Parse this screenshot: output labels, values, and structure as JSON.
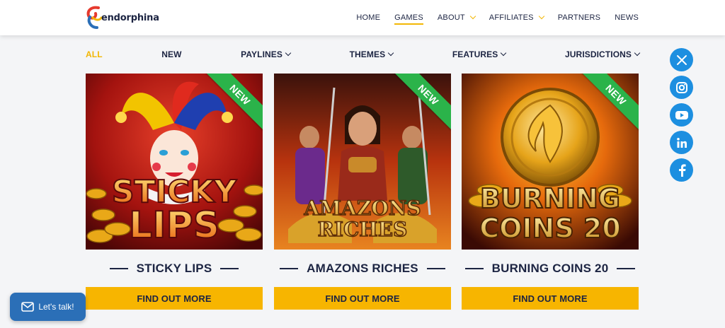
{
  "brand": {
    "name": "endorphina"
  },
  "nav": {
    "items": [
      {
        "label": "HOME",
        "dropdown": false,
        "active": false
      },
      {
        "label": "GAMES",
        "dropdown": false,
        "active": true
      },
      {
        "label": "ABOUT",
        "dropdown": true,
        "active": false
      },
      {
        "label": "AFFILIATES",
        "dropdown": true,
        "active": false
      },
      {
        "label": "PARTNERS",
        "dropdown": false,
        "active": false
      },
      {
        "label": "NEWS",
        "dropdown": false,
        "active": false
      }
    ]
  },
  "filters": {
    "items": [
      {
        "label": "ALL",
        "active": true,
        "dropdown": false
      },
      {
        "label": "NEW",
        "active": false,
        "dropdown": false
      },
      {
        "label": "PAYLINES",
        "active": false,
        "dropdown": true
      },
      {
        "label": "THEMES",
        "active": false,
        "dropdown": true
      },
      {
        "label": "FEATURES",
        "active": false,
        "dropdown": true
      },
      {
        "label": "JURISDICTIONS",
        "active": false,
        "dropdown": true
      }
    ]
  },
  "games": [
    {
      "title": "STICKY LIPS",
      "artwork_text": [
        "STICKY",
        "LIPS"
      ],
      "badge": "NEW",
      "cta": "FIND OUT MORE"
    },
    {
      "title": "AMAZONS RICHES",
      "artwork_text": [
        "AMAZONS",
        "RICHES"
      ],
      "badge": "NEW",
      "cta": "FIND OUT MORE"
    },
    {
      "title": "BURNING COINS 20",
      "artwork_text": [
        "BURNING",
        "COINS 20"
      ],
      "badge": "NEW",
      "cta": "FIND OUT MORE"
    }
  ],
  "social": {
    "items": [
      {
        "icon": "x-icon"
      },
      {
        "icon": "instagram-icon"
      },
      {
        "icon": "youtube-icon"
      },
      {
        "icon": "linkedin-icon"
      },
      {
        "icon": "facebook-icon"
      }
    ]
  },
  "chat": {
    "label": "Let's talk!"
  },
  "colors": {
    "accent": "#f7b500",
    "navy": "#1c2442",
    "new_badge": "#2bb34a",
    "social": "#1d8fe0",
    "chat": "#2b6fb7"
  }
}
